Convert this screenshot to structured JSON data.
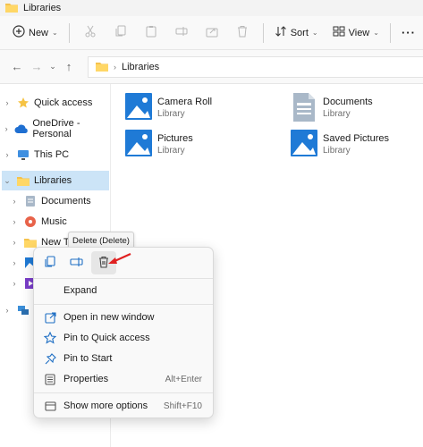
{
  "window": {
    "title": "Libraries"
  },
  "toolbar": {
    "new_label": "New",
    "sort_label": "Sort",
    "view_label": "View",
    "more_label": "···"
  },
  "address": {
    "path": "Libraries"
  },
  "sidebar": {
    "items": [
      {
        "label": "Quick access",
        "icon": "star-icon"
      },
      {
        "label": "OneDrive - Personal",
        "icon": "cloud-icon"
      },
      {
        "label": "This PC",
        "icon": "pc-icon"
      },
      {
        "label": "Libraries",
        "icon": "folder-icon",
        "selected": true
      },
      {
        "label": "Documents",
        "icon": "documents-icon"
      },
      {
        "label": "Music",
        "icon": "music-icon"
      },
      {
        "label": "New Text",
        "icon": "folder-icon"
      }
    ]
  },
  "libraries": [
    {
      "name": "Camera Roll",
      "type": "Library",
      "icon": "pictures-library-icon"
    },
    {
      "name": "Documents",
      "type": "Library",
      "icon": "documents-library-icon"
    },
    {
      "name": "Pictures",
      "type": "Library",
      "icon": "pictures-library-icon"
    },
    {
      "name": "Saved Pictures",
      "type": "Library",
      "icon": "pictures-library-icon"
    }
  ],
  "tooltip": {
    "text": "Delete (Delete)"
  },
  "context_menu": {
    "icon_actions": [
      "copy-icon",
      "rename-icon",
      "delete-icon"
    ],
    "expand_label": "Expand",
    "items": [
      {
        "label": "Open in new window",
        "shortcut": "",
        "icon": "open-window-icon"
      },
      {
        "label": "Pin to Quick access",
        "shortcut": "",
        "icon": "star-outline-icon"
      },
      {
        "label": "Pin to Start",
        "shortcut": "",
        "icon": "pin-icon"
      },
      {
        "label": "Properties",
        "shortcut": "Alt+Enter",
        "icon": "properties-icon"
      },
      {
        "label": "Show more options",
        "shortcut": "Shift+F10",
        "icon": "more-options-icon"
      }
    ]
  },
  "colors": {
    "accent": "#0067c0",
    "selection": "#cce4f7",
    "folder": "#f5c24c",
    "arrow": "#e02020"
  }
}
